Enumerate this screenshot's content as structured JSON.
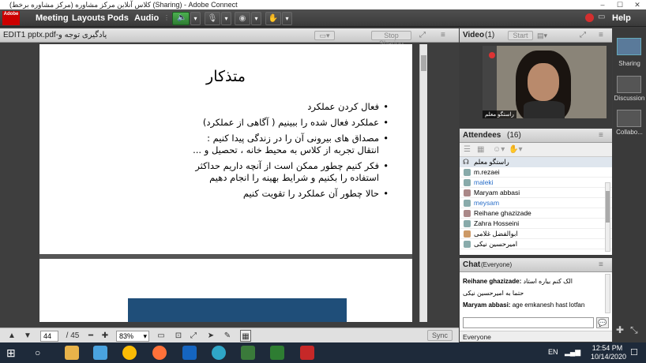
{
  "window": {
    "title": "کلاس آنلاین مرکز مشاوره (مرکز مشاوره برخط) (Sharing) - Adobe Connect"
  },
  "logo": {
    "text": "Adobe"
  },
  "menubar": {
    "items": [
      "Meeting",
      "Layouts",
      "Pods",
      "Audio"
    ],
    "help": "Help"
  },
  "share_pod": {
    "file_title": "EDIT1 pptx.pdf-یادگیری توجه و",
    "stop_sharing": "Stop Sharing",
    "slide": {
      "title": "متذکار",
      "bullets": [
        "فعال کردن عملکرد",
        "عملکرد فعال شده را ببینیم ( آگاهی از عملکرد)",
        "مصداق های بیرونی آن را در زندگی پیدا کنیم : انتقال تجربه از کلاس به محیط خانه ، تحصیل و ...",
        "فکر کنیم چطور ممکن است از آنچه داریم حداکثر استفاده را بکنیم و شرایط بهینه را انجام دهیم",
        "حالا چطور آن عملکرد را تقویت کنیم"
      ]
    },
    "controls": {
      "page_current": "44",
      "page_total": "/ 45",
      "zoom": "83%",
      "sync": "Sync"
    }
  },
  "video_pod": {
    "title": "Video",
    "count": "(1)",
    "start": "Start",
    "speaker_label": "راستگو معلم"
  },
  "attendees_pod": {
    "title": "Attendees",
    "count": "(16)",
    "host": "راستگو معلم",
    "list": [
      "m.rezaei",
      "maleki",
      "Maryam abbasi",
      "meysam",
      "Reihane ghazizade",
      "Zahra Hosseini",
      "ابوالفضل غلامی",
      "امیرحسین نیکی"
    ]
  },
  "chat_pod": {
    "title": "Chat",
    "scope": "(Everyone)",
    "messages": [
      {
        "from": "Reihane ghazizade:",
        "text": "الک کنم بیاره استاد"
      },
      {
        "from": "",
        "text": "حتما به امیرحسین نیکی"
      },
      {
        "from": "Maryam abbasi:",
        "text": "age emkanesh hast lotfan"
      }
    ],
    "recipient": "Everyone"
  },
  "layouts": {
    "items": [
      "Sharing",
      "Discussion",
      "Collabo..."
    ]
  },
  "taskbar": {
    "lang": "EN",
    "time": "12:54 PM",
    "date": "10/14/2020"
  },
  "colors": {
    "accent_green": "#2e7d32",
    "slide_blue": "#1f4e79",
    "record_red": "#d32f2f"
  }
}
